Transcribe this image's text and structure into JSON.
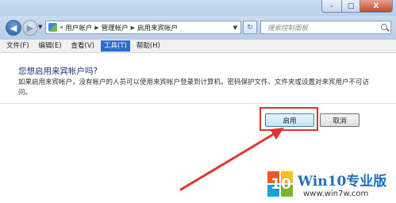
{
  "window": {
    "controls": {
      "minimize": "–",
      "maximize": "□",
      "close": "X"
    }
  },
  "navbar": {
    "back_glyph": "◀",
    "forward_glyph": "▶",
    "address": {
      "prefix": "«",
      "crumbs": [
        "用户帐户",
        "管理帐户",
        "启用来宾帐户"
      ]
    },
    "refresh_glyph": "↻",
    "search": {
      "placeholder": "搜索控制面板"
    }
  },
  "menubar": {
    "items": [
      {
        "label": "文件(F)"
      },
      {
        "label": "编辑(E)"
      },
      {
        "label": "查看(V)"
      },
      {
        "label": "工具(T)",
        "active": true
      },
      {
        "label": "帮助(H)"
      }
    ]
  },
  "dialog": {
    "heading": "您想启用来宾帐户吗?",
    "description": "如果启用来宾帐户，没有帐户的人员可以使用来宾帐户登录到计算机。密码保护文件、文件夹或设置对来宾用户不可访问。",
    "enable_button": "启用",
    "cancel_button": "取消"
  },
  "annotation": {
    "color": "#e0342f"
  },
  "watermark": {
    "logo_number": "10",
    "title": "Win10专业版",
    "url": "www.win7w.com"
  },
  "colors": {
    "accent": "#2d6bd0",
    "heading": "#1e3287",
    "annotation": "#e0342f"
  }
}
